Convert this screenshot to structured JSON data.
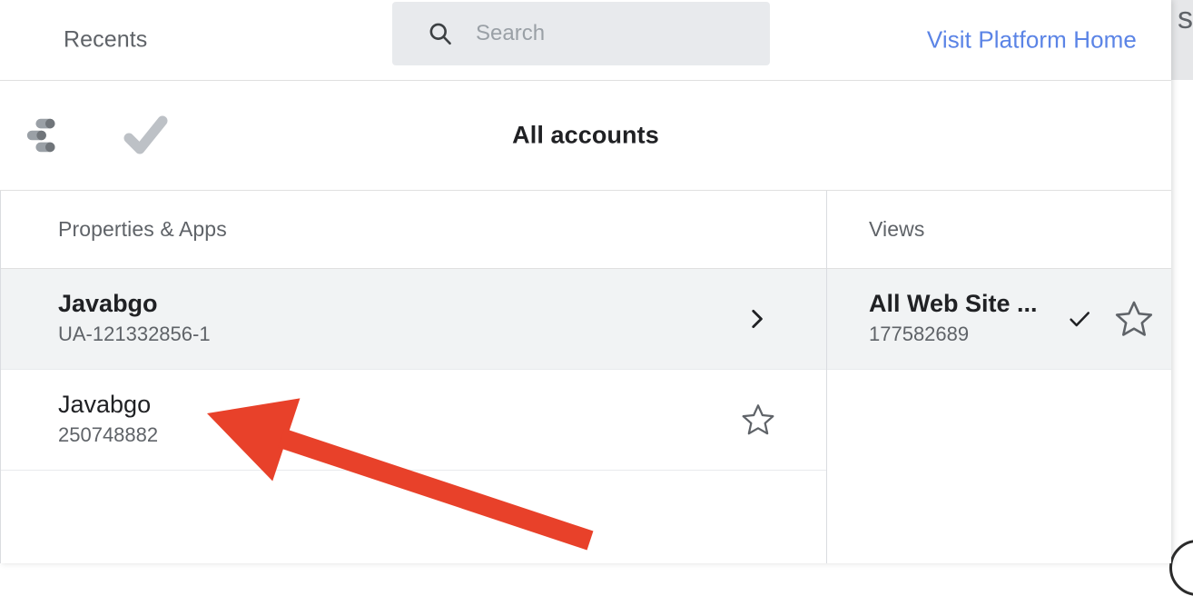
{
  "window": {
    "background_letter": "s"
  },
  "topbar": {
    "recents_label": "Recents",
    "search": {
      "placeholder": "Search",
      "value": "",
      "icon": "search-icon"
    },
    "visit_home_label": "Visit Platform Home",
    "visit_home_color": "#5b84e6"
  },
  "toolbar": {
    "filter_icon": "filter-tune-icon",
    "check_icon": "check-icon",
    "title": "All accounts"
  },
  "table": {
    "columns": [
      {
        "key": "properties",
        "header": "Properties & Apps"
      },
      {
        "key": "views",
        "header": "Views"
      }
    ],
    "properties_rows": [
      {
        "title": "Javabgo",
        "subtitle": "UA-121332856-1",
        "selected": true,
        "bold": true,
        "chevron_icon": "chevron-right-icon"
      },
      {
        "title": "Javabgo",
        "subtitle": "250748882",
        "selected": false,
        "bold": false,
        "star_icon": "star-outline-icon"
      }
    ],
    "views_rows": [
      {
        "title": "All Web Site ...",
        "subtitle": "177582689",
        "selected": true,
        "bold": true,
        "check_icon": "check-icon",
        "star_icon": "star-outline-icon"
      }
    ]
  },
  "annotation": {
    "arrow_color": "#e8412a",
    "arrow_tip": "228,455",
    "arrow_tail": "650,595"
  }
}
